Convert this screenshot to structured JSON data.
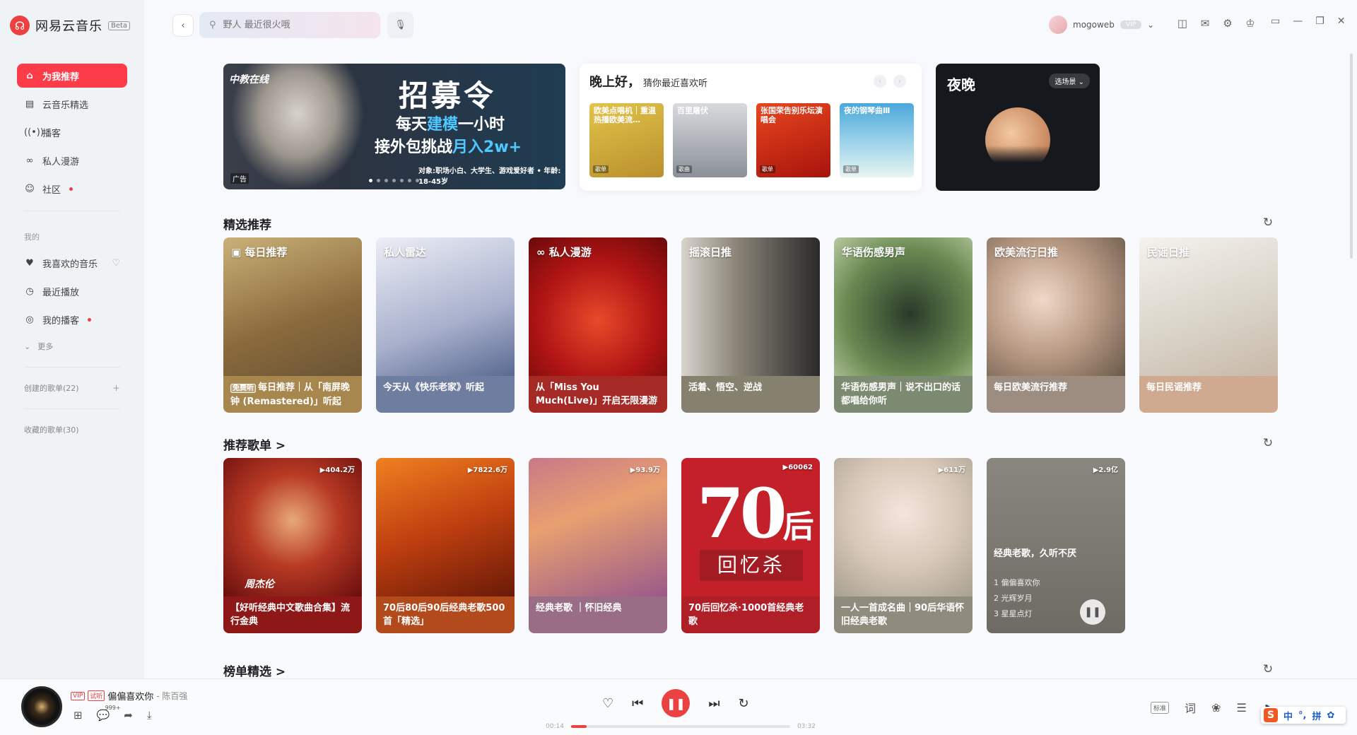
{
  "app": {
    "name": "网易云音乐",
    "beta": "Beta"
  },
  "sidebar": {
    "items": [
      {
        "label": "为我推荐",
        "icon": "home-icon",
        "active": true
      },
      {
        "label": "云音乐精选",
        "icon": "list-icon"
      },
      {
        "label": "播客",
        "icon": "podcast-icon"
      },
      {
        "label": "私人漫游",
        "icon": "roam-icon"
      },
      {
        "label": "社区",
        "icon": "community-icon",
        "dot": true
      }
    ],
    "mine_label": "我的",
    "mine_items": [
      {
        "label": "我喜欢的音乐",
        "icon": "heart-icon"
      },
      {
        "label": "最近播放",
        "icon": "clock-icon"
      },
      {
        "label": "我的播客",
        "icon": "podcast-icon",
        "dot": true
      }
    ],
    "more_label": "更多",
    "created_playlists": "创建的歌单(22)",
    "collected_playlists": "收藏的歌单(30)"
  },
  "topbar": {
    "search_placeholder": "野人 最近很火哦",
    "username": "mogoweb",
    "vip_badge": "VIP"
  },
  "banner": {
    "logo": "中教在线",
    "title": "招募令",
    "line1_pre": "每天",
    "line1_hl": "建模",
    "line1_post": "一小时",
    "line2_pre": "接外包挑战",
    "line2_hl": "月入2w+",
    "sub": "对象:职场小白、大学生、游戏爱好者 • 年龄: 18-45岁",
    "ad_tag": "广告"
  },
  "greeting": {
    "title": "晚上好，",
    "subtitle": "猜你最近喜欢听",
    "items": [
      {
        "title": "欧美点唱机｜重温热播欧美流…",
        "tag": "歌单",
        "color": "#c9a23a"
      },
      {
        "title": "百里屠伏",
        "tag": "歌曲",
        "color": "#8a8f98"
      },
      {
        "title": "张国荣告别乐坛演唱会",
        "tag": "歌单",
        "color": "#d0311e"
      },
      {
        "title": "夜的钢琴曲Ⅲ",
        "tag": "歌单",
        "color": "#7cc4e4"
      }
    ]
  },
  "night": {
    "title": "夜晚",
    "scene_button": "选场景"
  },
  "featured": {
    "title": "精选推荐",
    "cards": [
      {
        "title": "每日推荐",
        "free": "免费听",
        "label": "每日推荐｜从「南屏晚钟 (Remastered)」听起",
        "art": "#a89060",
        "label_bg": "#a8874f"
      },
      {
        "title": "私人雷达",
        "label": "今天从《快乐老家》听起",
        "art": "#c8cde0",
        "label_bg": "#6f7ea0"
      },
      {
        "title": "私人漫游",
        "label": "从「Miss You Much(Live)」开启无限漫游",
        "art": "#c4201c",
        "label_bg": "#a52a25"
      },
      {
        "title": "摇滚日推",
        "label": "活着、悟空、逆战",
        "art": "#6a6862",
        "label_bg": "#86806f"
      },
      {
        "title": "华语伤感男声",
        "label": "华语伤感男声｜说不出口的话都唱给你听",
        "art": "#4a6a3a",
        "label_bg": "#7d8a72"
      },
      {
        "title": "欧美流行日推",
        "label": "每日欧美流行推荐",
        "art": "#b8a690",
        "label_bg": "#9c8d80"
      },
      {
        "title": "民谣日推",
        "label": "每日民谣推荐",
        "art": "#e8e4dc",
        "label_bg": "#cfa990"
      }
    ]
  },
  "playlists": {
    "title": "推荐歌单 >",
    "cards": [
      {
        "count": "▶404.2万",
        "label": "【好听经典中文歌曲合集】流行金典",
        "art": "#b0201e",
        "label_bg": "#8e1818"
      },
      {
        "count": "▶7822.6万",
        "label": "70后80后90后经典老歌500首「精选」",
        "art": "#d05010",
        "label_bg": "#b34a1c"
      },
      {
        "count": "▶93.9万",
        "label": "经典老歌 ｜怀旧经典",
        "art": "#b4708a",
        "label_bg": "#9a6d86"
      },
      {
        "count": "▶60062",
        "label": "70后回忆杀·1000首经典老歌",
        "art": "#c4202a",
        "label_bg": "#b01f28"
      },
      {
        "count": "▶611万",
        "label": "一人一首成名曲｜90后华语怀旧经典老歌",
        "art": "#d8d4c8",
        "label_bg": "#8f8b7d"
      },
      {
        "count": "▶2.9亿",
        "label": "经典老歌，久听不厌",
        "art": "#6e6a64",
        "label_bg": "#6e6a64",
        "tracks": [
          "1 偏偏喜欢你",
          "2 光辉岁月",
          "3 星星点灯"
        ]
      }
    ],
    "big70": "70",
    "big70_suffix": "后",
    "memory": "回忆杀",
    "cover_text": "周杰伦"
  },
  "charts": {
    "title": "榜单精选 >"
  },
  "player": {
    "song": "偏偏喜欢你",
    "artist": "- 陈百强",
    "vip": "VIP",
    "trial": "试听",
    "comments": "999+",
    "current": "00:14",
    "total": "03:32",
    "progress": 0.07,
    "quality": "标准",
    "lyrics": "词"
  },
  "ime": {
    "logo": "S",
    "mode": "中",
    "punct": "°,",
    "pinyin": "拼"
  }
}
